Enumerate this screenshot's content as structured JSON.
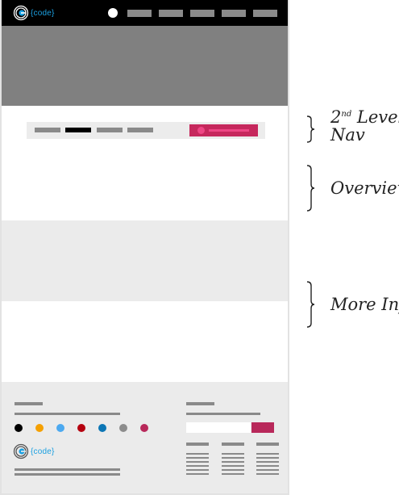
{
  "header": {
    "logo_text": "{code}",
    "nav_item_count_note": ""
  },
  "footer": {
    "logo_text": "{code}",
    "swatches": [
      "#000000",
      "#f5a000",
      "#4ca9f0",
      "#b5000f",
      "#0c76b5",
      "#8c8c8c",
      "#b8285a"
    ]
  },
  "annotations": {
    "second_level_nav": {
      "ordinal": "2",
      "suffix": "nd",
      "line1_rest": " Level",
      "line2": "Nav"
    },
    "overview": "Overview",
    "more_info": "More Info"
  },
  "colors": {
    "accent": "#c6285d",
    "accent_light": "#ee4785",
    "brand_blue": "#1ba0e1",
    "gray_block": "#808080"
  },
  "icons": {
    "logo": "code-logo-icon",
    "brace": "curly-brace-icon"
  }
}
